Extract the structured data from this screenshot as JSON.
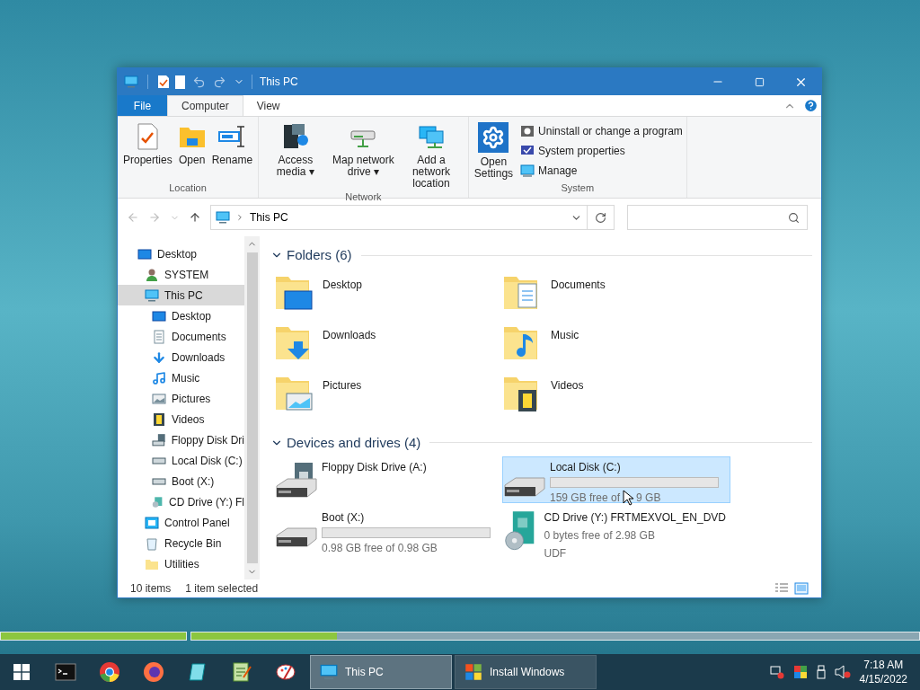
{
  "window": {
    "title": "This PC"
  },
  "tabs": [
    {
      "label": "File",
      "kind": "file",
      "selected": false
    },
    {
      "label": "Computer",
      "kind": "tab",
      "selected": true
    },
    {
      "label": "View",
      "kind": "tab",
      "selected": false
    }
  ],
  "ribbon_groups": [
    {
      "label": "Location",
      "buttons": [
        {
          "label": "Properties"
        },
        {
          "label": "Open"
        },
        {
          "label": "Rename"
        }
      ]
    },
    {
      "label": "Network",
      "buttons": [
        {
          "label": "Access media",
          "caret": "▾"
        },
        {
          "label": "Map network drive",
          "caret": "▾"
        },
        {
          "label": "Add a network location"
        }
      ]
    },
    {
      "label": "System",
      "buttons": [
        {
          "label": "Open Settings"
        }
      ],
      "small_buttons": [
        {
          "label": "Uninstall or change a program"
        },
        {
          "label": "System properties"
        },
        {
          "label": "Manage"
        }
      ]
    }
  ],
  "address": {
    "path": "This PC"
  },
  "nav_tree": [
    {
      "label": "Desktop",
      "selected": false,
      "children": [
        {
          "label": "SYSTEM",
          "selected": false
        },
        {
          "label": "This PC",
          "selected": true,
          "children": [
            {
              "label": "Desktop",
              "selected": false
            },
            {
              "label": "Documents",
              "selected": false
            },
            {
              "label": "Downloads",
              "selected": false
            },
            {
              "label": "Music",
              "selected": false
            },
            {
              "label": "Pictures",
              "selected": false
            },
            {
              "label": "Videos",
              "selected": false
            },
            {
              "label": "Floppy Disk Dri",
              "selected": false
            },
            {
              "label": "Local Disk (C:)",
              "selected": false
            },
            {
              "label": "Boot (X:)",
              "selected": false
            },
            {
              "label": "CD Drive (Y:) Fl",
              "selected": false
            }
          ]
        },
        {
          "label": "Control Panel",
          "selected": false
        },
        {
          "label": "Recycle Bin",
          "selected": false
        },
        {
          "label": "Utilities",
          "selected": false
        }
      ]
    }
  ],
  "folders": {
    "title": "Folders (6)",
    "expanded": true,
    "items": [
      {
        "name": "Desktop"
      },
      {
        "name": "Documents"
      },
      {
        "name": "Downloads"
      },
      {
        "name": "Music"
      },
      {
        "name": "Pictures"
      },
      {
        "name": "Videos"
      }
    ]
  },
  "drives": {
    "title": "Devices and drives (4)",
    "expanded": true,
    "items": [
      {
        "name": "Floppy Disk Drive (A:)",
        "kind": "floppy",
        "selected": false
      },
      {
        "name": "Local Disk (C:)",
        "kind": "disk",
        "selected": true,
        "free": "159 GB free of",
        "free_tail": "9 GB"
      },
      {
        "name": "Boot (X:)",
        "kind": "disk",
        "selected": false,
        "free": "0.98 GB free of 0.98 GB"
      },
      {
        "name": "CD Drive (Y:) FRTMEXVOL_EN_DVD",
        "kind": "cd",
        "selected": false,
        "free": "0 bytes free of 2.98 GB",
        "filesystem": "UDF"
      }
    ]
  },
  "status_bar": {
    "count": "10 items",
    "selection": "1 item selected"
  },
  "setup_progress": [
    {
      "level": 1
    },
    {
      "level": 0.2
    }
  ],
  "taskbar": {
    "tasks": [
      {
        "label": "This PC",
        "selected": true
      },
      {
        "label": "Install Windows",
        "selected": false
      }
    ],
    "time": "7:18 AM",
    "date": "4/15/2022"
  }
}
